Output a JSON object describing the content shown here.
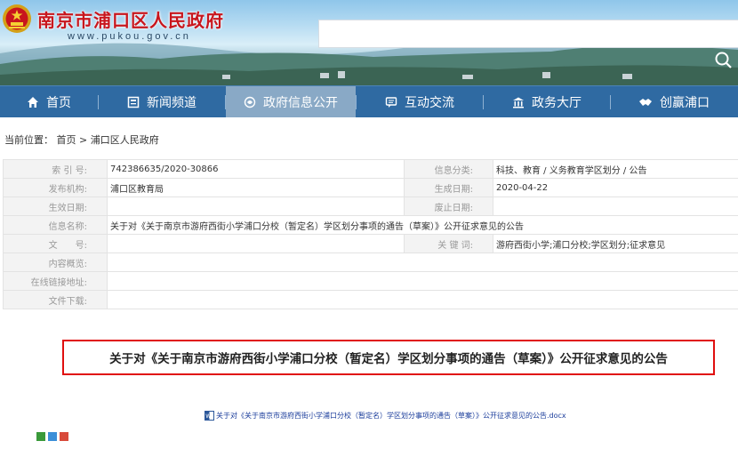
{
  "header": {
    "site_title": "南京市浦口区人民政府",
    "site_url": "www.pukou.gov.cn",
    "search_placeholder": ""
  },
  "nav": [
    {
      "label": "首页",
      "icon": "home-icon",
      "active": false
    },
    {
      "label": "新闻频道",
      "icon": "news-icon",
      "active": false
    },
    {
      "label": "政府信息公开",
      "icon": "info-open-icon",
      "active": true
    },
    {
      "label": "互动交流",
      "icon": "chat-icon",
      "active": false
    },
    {
      "label": "政务大厅",
      "icon": "hall-icon",
      "active": false
    },
    {
      "label": "创赢浦口",
      "icon": "handshake-icon",
      "active": false
    }
  ],
  "breadcrumb": {
    "prefix": "当前位置：",
    "home": "首页",
    "sep": ">",
    "current": "浦口区人民政府"
  },
  "info": {
    "index_label": "索 引 号:",
    "index_value": "742386635/2020-30866",
    "category_label": "信息分类:",
    "category_value": "科技、教育 / 义务教育学区划分 / 公告",
    "org_label": "发布机构:",
    "org_value": "浦口区教育局",
    "date_label": "生成日期:",
    "date_value": "2020-04-22",
    "effective_label": "生效日期:",
    "effective_value": "",
    "abolish_label": "废止日期:",
    "abolish_value": "",
    "name_label": "信息名称:",
    "name_value": "关于对《关于南京市游府西街小学浦口分校（暂定名）学区划分事项的通告（草案）》公开征求意见的公告",
    "doc_label": "文　　号:",
    "doc_value": "",
    "keyword_label": "关 键 词:",
    "keyword_value": "游府西街小学;浦口分校;学区划分;征求意见",
    "summary_label": "内容概览:",
    "summary_value": "",
    "link_label": "在线链接地址:",
    "link_value": "",
    "download_label": "文件下载:",
    "download_value": ""
  },
  "article": {
    "title": "关于对《关于南京市游府西街小学浦口分校（暂定名）学区划分事项的通告（草案）》公开征求意见的公告",
    "attachment": "关于对《关于南京市游府西街小学浦口分校（暂定名）学区划分事项的通告（草案）》公开征求意见的公告.docx"
  },
  "colors": {
    "nav_bg": "#2f6aa2",
    "nav_active": "#89a9c6",
    "title_red": "#c8161d",
    "highlight_border": "#e00f0f"
  }
}
